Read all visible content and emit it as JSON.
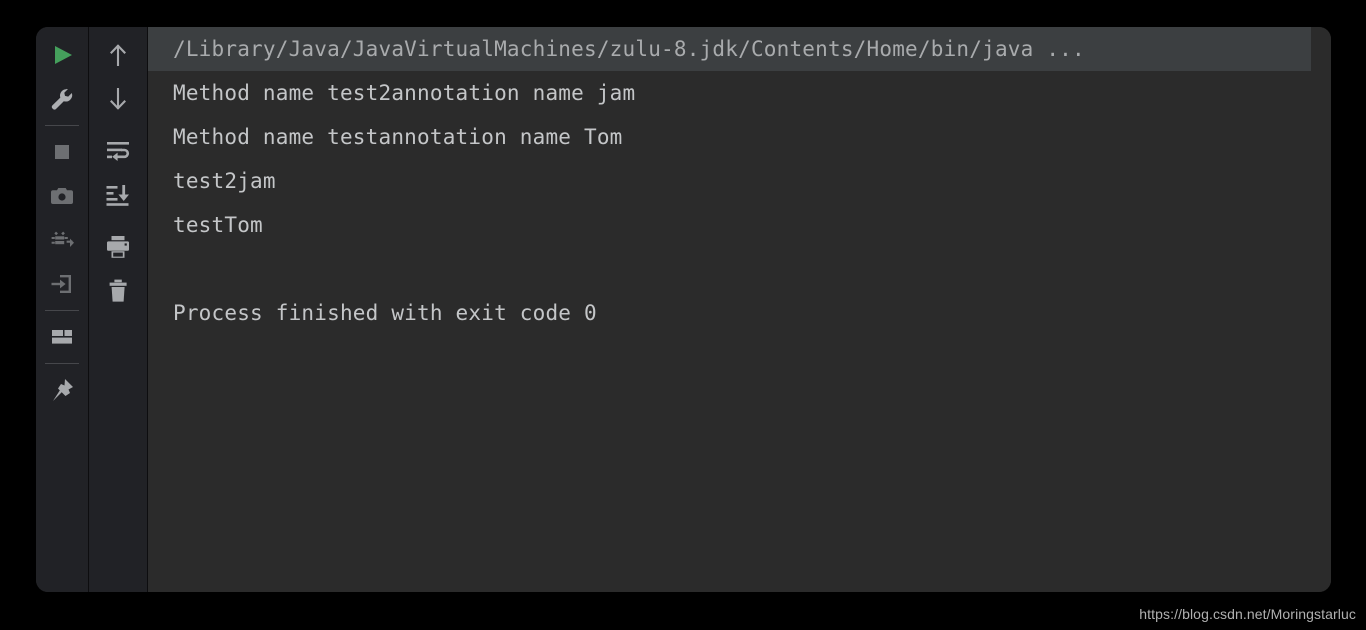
{
  "window": {
    "title": "Run console",
    "background_color": "#2b2b2b",
    "toolbar_color": "#212226",
    "accent_run_color": "#45a05c"
  },
  "run_toolbar": {
    "items": [
      {
        "name": "run-button",
        "icon": "play-icon",
        "label": "Run"
      },
      {
        "name": "settings-button",
        "icon": "wrench-icon",
        "label": "Edit Configuration"
      },
      {
        "name": "stop-button",
        "icon": "stop-square-icon",
        "label": "Stop"
      },
      {
        "name": "screenshot-button",
        "icon": "camera-icon",
        "label": "Screenshot"
      },
      {
        "name": "rerun-failed-button",
        "icon": "bug-arrow-icon",
        "label": "Rerun Failed Tests"
      },
      {
        "name": "import-button",
        "icon": "arrow-into-box-icon",
        "label": "Import Tests"
      },
      {
        "name": "layout-button",
        "icon": "layout-grid-icon",
        "label": "Layout"
      },
      {
        "name": "pin-button",
        "icon": "pin-icon",
        "label": "Pin Tab"
      }
    ]
  },
  "console_toolbar": {
    "items": [
      {
        "name": "scroll-up-button",
        "icon": "arrow-up-icon",
        "label": "Up the Stack Trace"
      },
      {
        "name": "scroll-down-button",
        "icon": "arrow-down-icon",
        "label": "Down the Stack Trace"
      },
      {
        "name": "soft-wrap-button",
        "icon": "soft-wrap-icon",
        "label": "Use Soft Wraps"
      },
      {
        "name": "scroll-to-end-button",
        "icon": "scroll-to-end-icon",
        "label": "Scroll to the End"
      },
      {
        "name": "print-button",
        "icon": "printer-icon",
        "label": "Print"
      },
      {
        "name": "clear-all-button",
        "icon": "trash-icon",
        "label": "Clear All"
      }
    ]
  },
  "console": {
    "lines": [
      {
        "text": "/Library/Java/JavaVirtualMachines/zulu-8.jdk/Contents/Home/bin/java ...",
        "highlighted": true
      },
      {
        "text": "Method name test2annotation name jam",
        "highlighted": false
      },
      {
        "text": "Method name testannotation name Tom",
        "highlighted": false
      },
      {
        "text": "test2jam",
        "highlighted": false
      },
      {
        "text": "testTom",
        "highlighted": false
      },
      {
        "text": " ",
        "highlighted": false
      },
      {
        "text": "Process finished with exit code 0",
        "highlighted": false
      }
    ]
  },
  "watermark": {
    "text": "https://blog.csdn.net/Moringstarluc"
  }
}
